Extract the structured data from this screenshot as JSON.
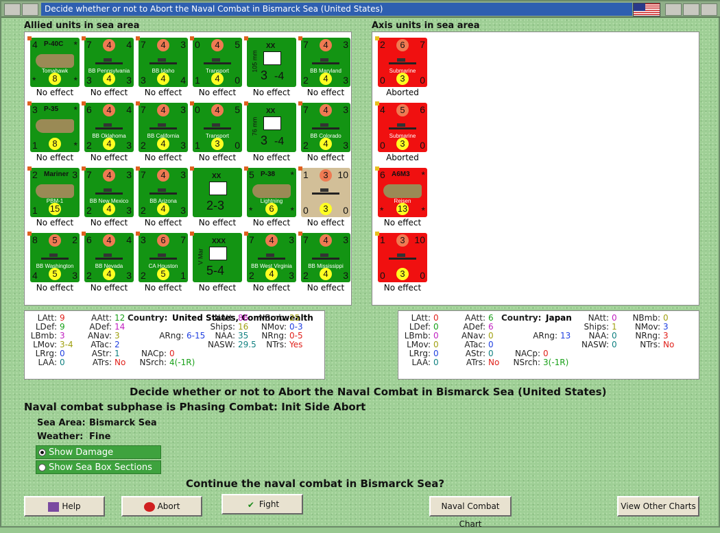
{
  "window": {
    "title": "Decide whether or not to Abort the Naval Combat in Bismarck Sea (United States)"
  },
  "allied": {
    "label": "Allied units in sea area",
    "units": [
      {
        "tl": "4",
        "tc": "P-40C",
        "tr": "*",
        "name": "Tomahawk",
        "bl": "*",
        "bc": "8",
        "br": "*",
        "effect": "No effect",
        "color": "g",
        "kind": "plane"
      },
      {
        "tl": "7",
        "tc": "4",
        "tr": "4",
        "name": "BB Pennsylvania",
        "bl": "3",
        "bc": "4",
        "br": "3",
        "effect": "No effect",
        "color": "g",
        "kind": "ship"
      },
      {
        "tl": "7",
        "tc": "4",
        "tr": "3",
        "name": "BB Idaho",
        "bl": "3",
        "bc": "4",
        "br": "4",
        "effect": "No effect",
        "color": "g",
        "kind": "ship"
      },
      {
        "tl": "0",
        "tc": "4",
        "tr": "5",
        "name": "Transport",
        "bl": "1",
        "bc": "4",
        "br": "0",
        "effect": "No effect",
        "color": "g",
        "kind": "ship"
      },
      {
        "tl": "",
        "tc": "XX",
        "tr": "",
        "name": "105 mm",
        "bl": "",
        "bc": "3",
        "br": "-4",
        "effect": "No effect",
        "color": "g",
        "kind": "unit"
      },
      {
        "tl": "7",
        "tc": "4",
        "tr": "3",
        "name": "BB Maryland",
        "bl": "2",
        "bc": "4",
        "br": "3",
        "effect": "No effect",
        "color": "g",
        "kind": "ship"
      },
      {
        "tl": "3",
        "tc": "P-35",
        "tr": "*",
        "name": "",
        "bl": "1",
        "bc": "8",
        "br": "*",
        "effect": "No effect",
        "color": "g",
        "kind": "plane"
      },
      {
        "tl": "6",
        "tc": "4",
        "tr": "4",
        "name": "BB Oklahoma",
        "bl": "2",
        "bc": "4",
        "br": "3",
        "effect": "No effect",
        "color": "g",
        "kind": "ship"
      },
      {
        "tl": "7",
        "tc": "4",
        "tr": "3",
        "name": "BB California",
        "bl": "2",
        "bc": "4",
        "br": "3",
        "effect": "No effect",
        "color": "g",
        "kind": "ship"
      },
      {
        "tl": "0",
        "tc": "4",
        "tr": "5",
        "name": "Transport",
        "bl": "1",
        "bc": "3",
        "br": "0",
        "effect": "No effect",
        "color": "g",
        "kind": "ship"
      },
      {
        "tl": "",
        "tc": "XX",
        "tr": "",
        "name": "76 mm",
        "bl": "",
        "bc": "3",
        "br": "-4",
        "effect": "No effect",
        "color": "g",
        "kind": "unit"
      },
      {
        "tl": "7",
        "tc": "4",
        "tr": "3",
        "name": "BB Colorado",
        "bl": "2",
        "bc": "4",
        "br": "3",
        "effect": "No effect",
        "color": "g",
        "kind": "ship"
      },
      {
        "tl": "2",
        "tc": "Mariner",
        "tr": "3",
        "name": "PBM-1",
        "bl": "1",
        "bc": "15",
        "br": "",
        "effect": "No effect",
        "color": "g",
        "kind": "plane"
      },
      {
        "tl": "7",
        "tc": "4",
        "tr": "3",
        "name": "BB New Mexico",
        "bl": "2",
        "bc": "4",
        "br": "3",
        "effect": "No effect",
        "color": "g",
        "kind": "ship"
      },
      {
        "tl": "7",
        "tc": "4",
        "tr": "3",
        "name": "BB Arizona",
        "bl": "2",
        "bc": "4",
        "br": "3",
        "effect": "No effect",
        "color": "g",
        "kind": "ship"
      },
      {
        "tl": "",
        "tc": "XX",
        "tr": "",
        "name": "",
        "bl": "",
        "bc": "2-3",
        "br": "",
        "effect": "No effect",
        "color": "g",
        "kind": "unit"
      },
      {
        "tl": "5",
        "tc": "P-38",
        "tr": "*",
        "name": "Lightning",
        "bl": "*",
        "bc": "6",
        "br": "*",
        "effect": "No effect",
        "color": "g",
        "kind": "plane"
      },
      {
        "tl": "1",
        "tc": "3",
        "tr": "10",
        "name": "",
        "bl": "0",
        "bc": "3",
        "br": "0",
        "effect": "No effect",
        "color": "t",
        "kind": "ship"
      },
      {
        "tl": "8",
        "tc": "5",
        "tr": "2",
        "name": "BB Washington",
        "bl": "4",
        "bc": "5",
        "br": "3",
        "effect": "No effect",
        "color": "g",
        "kind": "ship"
      },
      {
        "tl": "6",
        "tc": "4",
        "tr": "4",
        "name": "BB Nevada",
        "bl": "2",
        "bc": "4",
        "br": "3",
        "effect": "No effect",
        "color": "g",
        "kind": "ship"
      },
      {
        "tl": "3",
        "tc": "6",
        "tr": "7",
        "name": "CA Houston",
        "bl": "2",
        "bc": "5",
        "br": "1",
        "effect": "No effect",
        "color": "g",
        "kind": "ship"
      },
      {
        "tl": "",
        "tc": "XXX",
        "tr": "",
        "name": "V Mar",
        "bl": "",
        "bc": "5-4",
        "br": "",
        "effect": "No effect",
        "color": "g",
        "kind": "unit"
      },
      {
        "tl": "7",
        "tc": "4",
        "tr": "3",
        "name": "BB West Virginia",
        "bl": "2",
        "bc": "4",
        "br": "3",
        "effect": "No effect",
        "color": "g",
        "kind": "ship"
      },
      {
        "tl": "7",
        "tc": "4",
        "tr": "3",
        "name": "BB Mississippi",
        "bl": "2",
        "bc": "4",
        "br": "3",
        "effect": "No effect",
        "color": "g",
        "kind": "ship"
      }
    ]
  },
  "axis": {
    "label": "Axis units in sea area",
    "units": [
      {
        "tl": "2",
        "tc": "6",
        "tr": "7",
        "name": "Submarine",
        "bl": "0",
        "bc": "3",
        "br": "0",
        "effect": "Aborted",
        "color": "r",
        "kind": "ship"
      },
      {
        "tl": "4",
        "tc": "5",
        "tr": "6",
        "name": "Submarine",
        "bl": "0",
        "bc": "3",
        "br": "0",
        "effect": "Aborted",
        "color": "r",
        "kind": "ship"
      },
      {
        "tl": "6",
        "tc": "A6M3",
        "tr": "*",
        "name": "Reisen",
        "bl": "*",
        "bc": "13",
        "br": "*",
        "effect": "No effect",
        "color": "r",
        "kind": "plane"
      },
      {
        "tl": "1",
        "tc": "3",
        "tr": "10",
        "name": "",
        "bl": "0",
        "bc": "3",
        "br": "0",
        "effect": "No effect",
        "color": "r",
        "kind": "ship"
      }
    ]
  },
  "allied_stats": {
    "country_label": "Country:",
    "country": "United States, Commonwealth",
    "rows": [
      [
        "LAtt:",
        "9",
        "AAtt:",
        "12",
        "NAtt:",
        "86",
        "NBmb:",
        "25"
      ],
      [
        "LDef:",
        "9",
        "ADef:",
        "14",
        "Ships:",
        "16",
        "NMov:",
        "0-3"
      ],
      [
        "LBmb:",
        "3",
        "ANav:",
        "3",
        "ARng:",
        "6-15",
        "NAA:",
        "35",
        "NRng:",
        "0-5"
      ],
      [
        "LMov:",
        "3-4",
        "ATac:",
        "2",
        "NASW:",
        "29.5",
        "NTrs:",
        "Yes"
      ],
      [
        "LRrg:",
        "0",
        "AStr:",
        "1",
        "NACp:",
        "0"
      ],
      [
        "LAA:",
        "0",
        "ATrs:",
        "No",
        "NSrch:",
        "4(-1R)"
      ]
    ]
  },
  "axis_stats": {
    "country_label": "Country:",
    "country": "Japan",
    "rows": [
      [
        "LAtt:",
        "0",
        "AAtt:",
        "6",
        "NAtt:",
        "0",
        "NBmb:",
        "0"
      ],
      [
        "LDef:",
        "0",
        "ADef:",
        "6",
        "Ships:",
        "1",
        "NMov:",
        "3"
      ],
      [
        "LBmb:",
        "0",
        "ANav:",
        "0",
        "ARng:",
        "13",
        "NAA:",
        "0",
        "NRng:",
        "3"
      ],
      [
        "LMov:",
        "0",
        "ATac:",
        "0",
        "NASW:",
        "0",
        "NTrs:",
        "No"
      ],
      [
        "LRrg:",
        "0",
        "AStr:",
        "0",
        "NACp:",
        "0"
      ],
      [
        "LAA:",
        "0",
        "ATrs:",
        "No",
        "NSrch:",
        "3(-1R)"
      ]
    ]
  },
  "messages": {
    "headline": "Decide whether or not to Abort the Naval Combat in Bismarck Sea (United States)",
    "subphase": "Naval combat subphase is Phasing Combat: Init Side Abort",
    "sea_area_label": "Sea Area:",
    "sea_area": "Bismarck Sea",
    "weather_label": "Weather:",
    "weather": "Fine",
    "question": "Continue the naval combat in Bismarck Sea?"
  },
  "options": {
    "show_damage": "Show Damage",
    "show_sections": "Show Sea Box Sections"
  },
  "buttons": {
    "help": "Help",
    "abort": "Abort",
    "fight": "Fight",
    "chart": "Naval Combat Chart",
    "other": "View Other Charts"
  },
  "colors": {
    "latt": "#e0201a",
    "ldef": "#18a018",
    "lbmb": "#c020c0",
    "lmov": "#a0a010",
    "lrng": "#c020c0",
    "laa": "#2040e0",
    "natt": "#e0201a",
    "ships": "#18a018",
    "naa": "#2040e0",
    "nasw": "#e08010",
    "nbmb": "#c020c0",
    "nmov": "#a0a010",
    "nrng": "#108080",
    "ntrs": "#c020c0",
    "arng": "#108080"
  }
}
